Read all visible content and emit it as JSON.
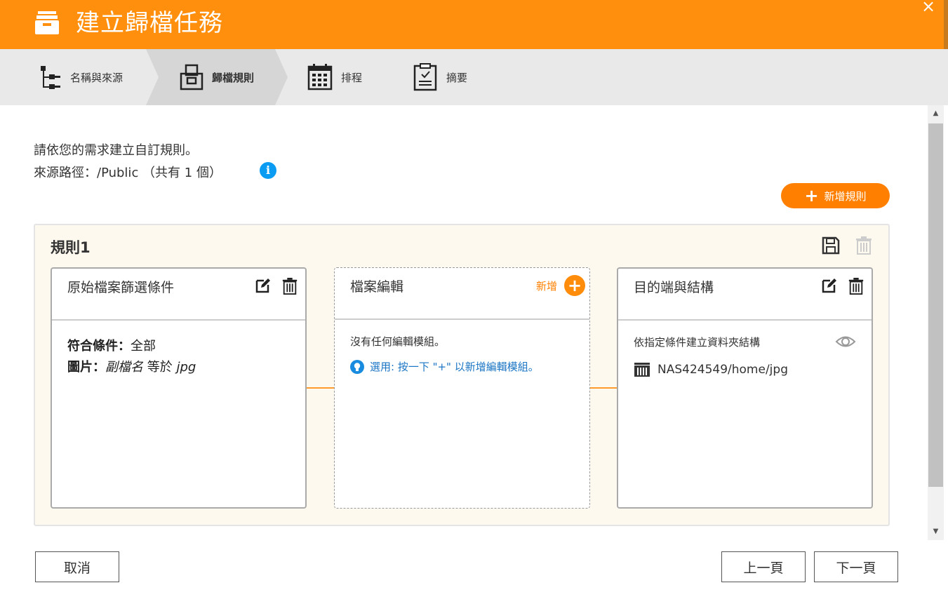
{
  "window": {
    "title": "建立歸檔任務",
    "close_glyph": "×"
  },
  "steps": [
    {
      "label": "名稱與來源"
    },
    {
      "label": "歸檔規則"
    },
    {
      "label": "排程"
    },
    {
      "label": "摘要"
    }
  ],
  "intro": {
    "line1": "請依您的需求建立自訂規則。",
    "line2": "來源路徑：/Public （共有 1 個）",
    "info_glyph": "i"
  },
  "add_rule_button": {
    "plus": "+",
    "label": "新增規則"
  },
  "rule": {
    "title": "規則1",
    "filter_card": {
      "title": "原始檔案篩選條件",
      "match_label": "符合條件：",
      "match_value": "全部",
      "image_label": "圖片：",
      "ext_field": "副檔名",
      "operator": " 等於 ",
      "ext_value": "jpg"
    },
    "edit_card": {
      "title": "檔案編輯",
      "add_label": "新增",
      "add_glyph": "+",
      "empty_text": "沒有任何編輯模組。",
      "hint_text": "選用: 按一下 \"+\" 以新增編輯模組。"
    },
    "dest_card": {
      "title": "目的端與結構",
      "description": "依指定條件建立資料夾結構",
      "path": "NAS424549/home/jpg"
    }
  },
  "footer": {
    "cancel": "取消",
    "prev": "上一頁",
    "next": "下一頁"
  },
  "colors": {
    "accent": "#ff8f0c",
    "rule_bg": "#fef9ef",
    "info_blue": "#0a9cf2",
    "hint_blue": "#1a75c4"
  },
  "icons": [
    "archive-icon",
    "close-icon",
    "tree-icon",
    "archive-rule-icon",
    "calendar-icon",
    "summary-icon",
    "info-icon",
    "save-icon",
    "trash-icon",
    "edit-icon",
    "plus-icon",
    "bulb-icon",
    "eye-icon",
    "nas-icon"
  ]
}
